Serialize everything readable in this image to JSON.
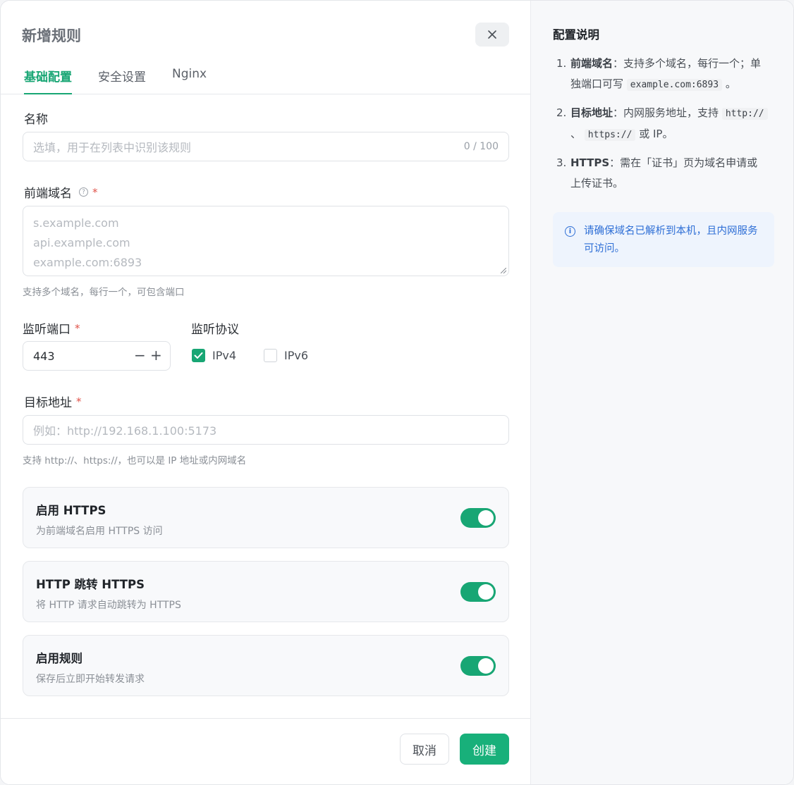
{
  "dialog": {
    "title": "新增规则",
    "tabs": [
      "基础配置",
      "安全设置",
      "Nginx"
    ]
  },
  "form": {
    "name": {
      "label": "名称",
      "placeholder": "选填，用于在列表中识别该规则",
      "counter": "0 / 100"
    },
    "domains": {
      "label": "前端域名",
      "required": "*",
      "placeholder_lines": [
        "s.example.com",
        "api.example.com",
        "example.com:6893"
      ],
      "hint": "支持多个域名，每行一个，可包含端口"
    },
    "port": {
      "label": "监听端口",
      "required": "*",
      "value": "443",
      "minus": "−",
      "plus": "+"
    },
    "protocol": {
      "label": "监听协议",
      "ipv4": "IPv4",
      "ipv6": "IPv6",
      "ipv4_checked": true,
      "ipv6_checked": false
    },
    "target": {
      "label": "目标地址",
      "required": "*",
      "placeholder": "例如：http://192.168.1.100:5173",
      "hint": "支持 http://、https://，也可以是 IP 地址或内网域名"
    },
    "toggles": [
      {
        "title": "启用 HTTPS",
        "desc": "为前端域名启用 HTTPS 访问",
        "on": true
      },
      {
        "title": "HTTP 跳转 HTTPS",
        "desc": "将 HTTP 请求自动跳转为 HTTPS",
        "on": true
      },
      {
        "title": "启用规则",
        "desc": "保存后立即开始转发请求",
        "on": true
      }
    ]
  },
  "footer": {
    "cancel": "取消",
    "create": "创建"
  },
  "side": {
    "title": "配置说明",
    "steps": [
      {
        "num": "1.",
        "strong": "前端域名",
        "text_a": "：支持多个域名，每行一个；单独端口可写",
        "code_a": "example.com:6893",
        "text_b": "。"
      },
      {
        "num": "2.",
        "strong": "目标地址",
        "text_a": "：内网服务地址，支持",
        "code_a": "http://",
        "sep": "、",
        "code_b": "https://",
        "text_b": "或 IP。"
      },
      {
        "num": "3.",
        "strong": "HTTPS",
        "text_a": "：需在「证书」页为域名申请或上传证书。"
      }
    ],
    "info": "请确保域名已解析到本机，且内网服务可访问。"
  },
  "colors": {
    "accent": "#18a674",
    "required": "#e0534a",
    "info": "#2f6fd6"
  }
}
